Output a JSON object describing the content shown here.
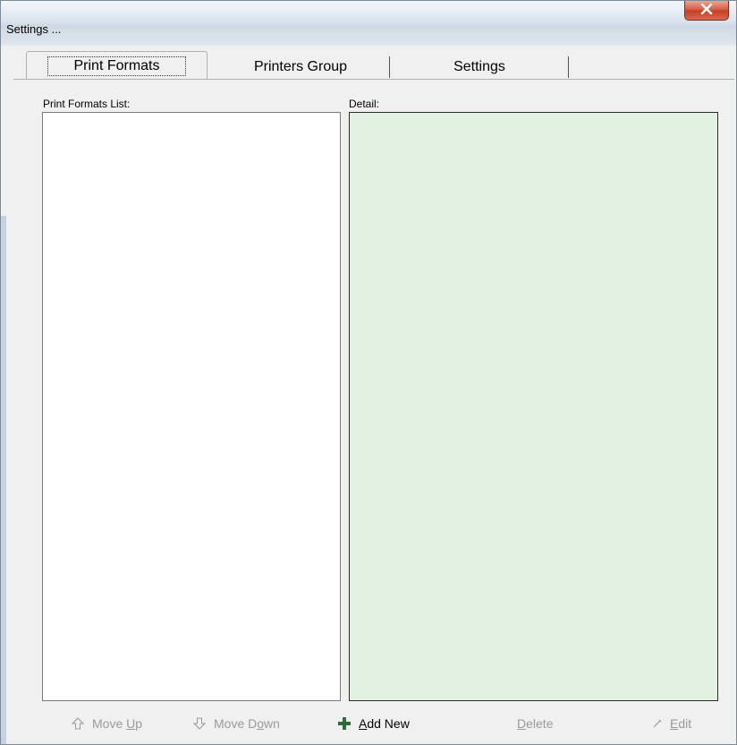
{
  "window": {
    "title": "Settings ..."
  },
  "tabs": [
    {
      "label": "Print Formats",
      "active": true
    },
    {
      "label": "Printers Group",
      "active": false
    },
    {
      "label": "Settings",
      "active": false
    }
  ],
  "panel": {
    "list_label": "Print Formats List:",
    "detail_label": "Detail:",
    "list_items": []
  },
  "buttons": {
    "move_up": {
      "pre": "Move ",
      "key": "U",
      "post": "p",
      "enabled": false,
      "icon": "arrow-up-icon"
    },
    "move_down": {
      "pre": "Move D",
      "key": "o",
      "post": "wn",
      "enabled": false,
      "icon": "arrow-down-icon"
    },
    "add_new": {
      "pre": "",
      "key": "A",
      "post": "dd New",
      "enabled": true,
      "icon": "plus-icon"
    },
    "delete": {
      "pre": "",
      "key": "D",
      "post": "elete",
      "enabled": false
    },
    "edit": {
      "pre": "",
      "key": "E",
      "post": "dit",
      "enabled": false,
      "icon": "pencil-icon"
    }
  },
  "colors": {
    "detail_background": "#e2f1e1",
    "add_icon": "#2e6b3e",
    "close_button": "#c63c25"
  }
}
